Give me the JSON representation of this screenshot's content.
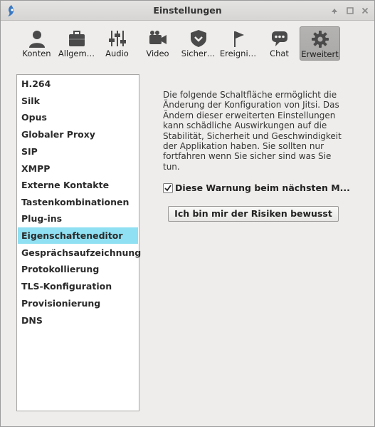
{
  "window": {
    "title": "Einstellungen"
  },
  "toolbar": {
    "items": [
      {
        "label": "Konten",
        "icon": "user-icon"
      },
      {
        "label": "Allgem…",
        "icon": "briefcase-icon"
      },
      {
        "label": "Audio",
        "icon": "sliders-icon"
      },
      {
        "label": "Video",
        "icon": "video-camera-icon"
      },
      {
        "label": "Sicher…",
        "icon": "shield-icon"
      },
      {
        "label": "Ereigni…",
        "icon": "flag-icon"
      },
      {
        "label": "Chat",
        "icon": "chat-bubble-icon"
      },
      {
        "label": "Erweitert",
        "icon": "gear-icon",
        "active": true
      }
    ]
  },
  "sidebar": {
    "items": [
      {
        "label": "H.264"
      },
      {
        "label": "Silk"
      },
      {
        "label": "Opus"
      },
      {
        "label": "Globaler Proxy"
      },
      {
        "label": "SIP"
      },
      {
        "label": "XMPP"
      },
      {
        "label": "Externe Kontakte"
      },
      {
        "label": "Tastenkombinationen"
      },
      {
        "label": "Plug-ins"
      },
      {
        "label": "Eigenschafteneditor",
        "selected": true
      },
      {
        "label": "Gesprächsaufzeichnung"
      },
      {
        "label": "Protokollierung"
      },
      {
        "label": "TLS-Konfiguration"
      },
      {
        "label": "Provisionierung"
      },
      {
        "label": "DNS"
      }
    ]
  },
  "main": {
    "description_lines": [
      "Die folgende Schaltfläche ermöglicht die",
      "Änderung der Konfiguration von Jitsi. Das",
      "Ändern dieser erweiterten Einstellungen",
      "kann schädliche Auswirkungen auf die",
      "Stabilität, Sicherheit und Geschwindigkeit",
      "der Applikation haben. Sie sollten nur",
      "fortfahren wenn Sie sicher sind was Sie",
      "tun."
    ],
    "checkbox_label": "Diese Warnung beim nächsten M...",
    "checkbox_checked": true,
    "risk_button_label": "Ich bin mir der Risiken bewusst"
  },
  "colors": {
    "selected_item": "#8fe0f2",
    "active_tool": "#aeadab",
    "window_bg": "#eeedeb"
  }
}
